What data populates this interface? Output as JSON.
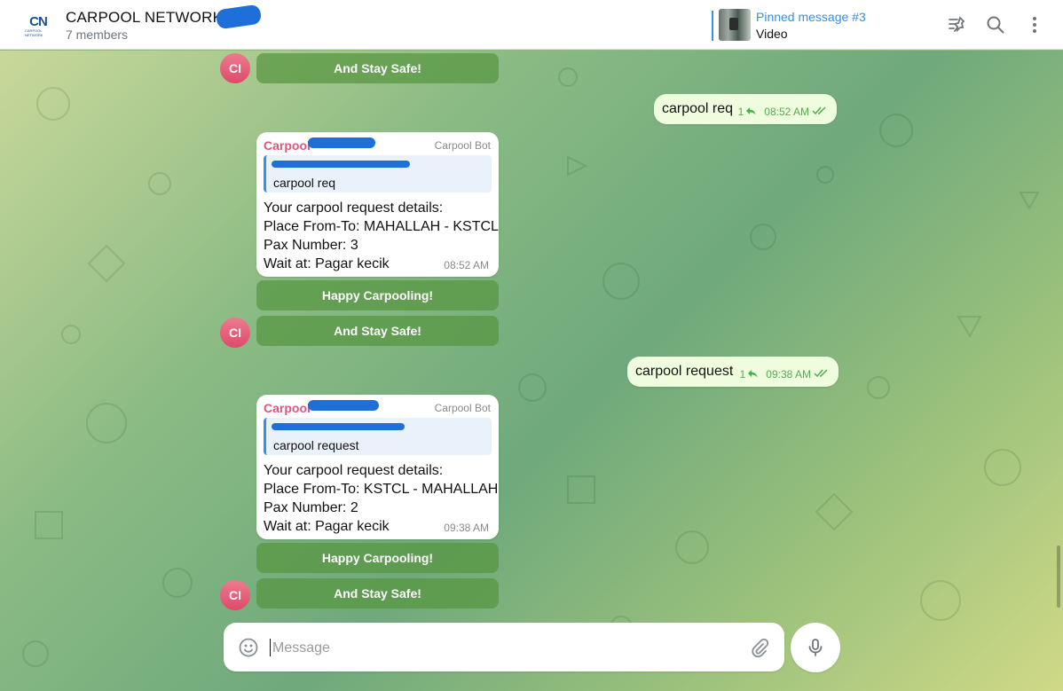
{
  "header": {
    "logo_text": "CN",
    "logo_subtext": "CARPOOL NETWORK",
    "title": "CARPOOL NETWORK",
    "subtitle": "7 members",
    "pinned": {
      "title": "Pinned message #3",
      "text": "Video"
    },
    "icons": [
      "unpin-icon",
      "search-icon",
      "more-vertical-icon"
    ]
  },
  "messages": {
    "stay_safe_1": "And Stay Safe!",
    "avatar_initials": "CI",
    "out_1": {
      "text": "carpool req",
      "replies": "1",
      "time": "08:52 AM"
    },
    "bot_1": {
      "sender": "Carpool",
      "role": "Carpool Bot",
      "reply_text": "carpool req",
      "lines": [
        "Your carpool request details:",
        "Place From-To: MAHALLAH - KSTCL",
        "Pax Number: 3",
        "Wait at: Pagar kecik"
      ],
      "time": "08:52 AM"
    },
    "happy_1": "Happy Carpooling!",
    "stay_safe_2": "And Stay Safe!",
    "out_2": {
      "text": "carpool request",
      "replies": "1",
      "time": "09:38 AM"
    },
    "bot_2": {
      "sender": "Carpool",
      "role": "Carpool Bot",
      "reply_text": "carpool request",
      "lines": [
        "Your carpool request details:",
        "Place From-To: KSTCL - MAHALLAH",
        "Pax Number: 2",
        "Wait at: Pagar kecik"
      ],
      "time": "09:38 AM"
    },
    "happy_2": "Happy Carpooling!",
    "stay_safe_3": "And Stay Safe!"
  },
  "composer": {
    "placeholder": "Message",
    "value": ""
  },
  "colors": {
    "accent": "#3390ec",
    "sender": "#e2557a",
    "outgoing_bubble": "#effdde",
    "check": "#4fae4e",
    "keyboard_button": "#5a9a42"
  }
}
